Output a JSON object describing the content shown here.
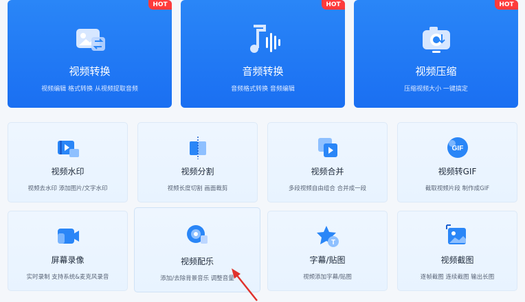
{
  "hot_badge": "HOT",
  "big_cards": [
    {
      "title": "视频转换",
      "desc": "视频编辑 格式转换 从视频提取音频",
      "icon": "video-convert-icon"
    },
    {
      "title": "音频转换",
      "desc": "音频格式转换 音频编辑",
      "icon": "audio-convert-icon"
    },
    {
      "title": "视频压缩",
      "desc": "压缩视频大小 一键搞定",
      "icon": "video-compress-icon"
    }
  ],
  "small_cards": [
    {
      "title": "视频水印",
      "desc": "视频去水印 添加图片/文字水印",
      "icon": "video-watermark-icon"
    },
    {
      "title": "视频分割",
      "desc": "视频长度切割 画面裁剪",
      "icon": "video-split-icon"
    },
    {
      "title": "视频合并",
      "desc": "多段视频自由组合 合并成一段",
      "icon": "video-merge-icon"
    },
    {
      "title": "视频转GIF",
      "desc": "截取视频片段 制作成GIF",
      "icon": "gif-icon",
      "icon_text": "GIF"
    },
    {
      "title": "屏幕录像",
      "desc": "实时录制 支持系统&麦克风录音",
      "icon": "screen-record-icon"
    },
    {
      "title": "视频配乐",
      "desc": "添加/去除背景音乐 调整音量",
      "icon": "music-icon"
    },
    {
      "title": "字幕/贴图",
      "desc": "视频添加字幕/贴图",
      "icon": "subtitle-icon",
      "icon_text": "T"
    },
    {
      "title": "视频截图",
      "desc": "逐帧截图 连续截图 输出长图",
      "icon": "screenshot-icon"
    }
  ],
  "colors": {
    "primary": "#1a6ff2",
    "hot": "#ff3b3b",
    "arrow": "#e0322c"
  }
}
